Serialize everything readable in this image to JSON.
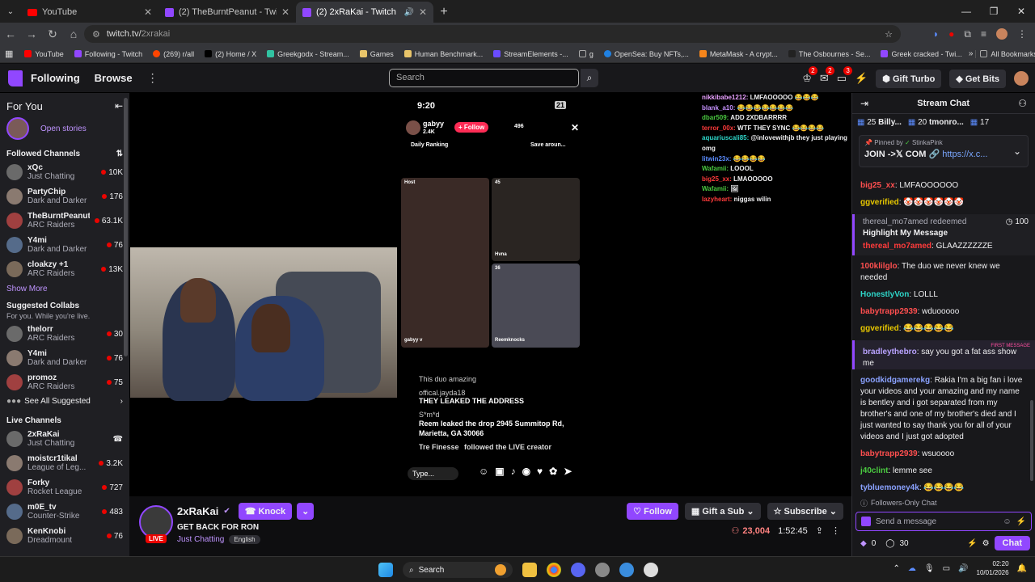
{
  "browser": {
    "tabs": [
      {
        "title": "YouTube",
        "favicon": "youtube-icon"
      },
      {
        "title": "(2) TheBurntPeanut - Twitch",
        "favicon": "twitch-icon"
      },
      {
        "title": "(2) 2xRaKai - Twitch",
        "favicon": "twitch-icon",
        "active": true
      }
    ],
    "url_host": "twitch.tv/",
    "url_path": "2xrakai",
    "bookmarks": [
      "YouTube",
      "Following - Twitch",
      "(269) r/all",
      "(2) Home / X",
      "Greekgodx - Stream...",
      "Games",
      "Human Benchmark...",
      "StreamElements -...",
      "g",
      "OpenSea: Buy NFTs,...",
      "MetaMask - A crypt...",
      "The Osbournes - Se...",
      "Greek cracked - Twi..."
    ],
    "all_bookmarks": "All Bookmarks"
  },
  "nav": {
    "following": "Following",
    "browse": "Browse",
    "search_placeholder": "Search",
    "notif_badges": [
      "2",
      "2",
      "3"
    ],
    "turbo": "Gift Turbo",
    "bits": "Get Bits"
  },
  "sidebar": {
    "for_you": "For You",
    "open_stories": "Open stories",
    "followed_title": "Followed Channels",
    "followed": [
      {
        "name": "xQc",
        "game": "Just Chatting",
        "viewers": "10K"
      },
      {
        "name": "PartyChip",
        "game": "Dark and Darker",
        "viewers": "176"
      },
      {
        "name": "TheBurntPeanut",
        "game": "ARC Raiders",
        "viewers": "63.1K"
      },
      {
        "name": "Y4mi",
        "game": "Dark and Darker",
        "viewers": "76"
      },
      {
        "name": "cloakzy +1",
        "game": "ARC Raiders",
        "viewers": "13K"
      }
    ],
    "show_more": "Show More",
    "suggested_title": "Suggested Collabs",
    "suggested_sub": "For you. While you're live.",
    "suggested": [
      {
        "name": "thelorr",
        "game": "ARC Raiders",
        "viewers": "30"
      },
      {
        "name": "Y4mi",
        "game": "Dark and Darker",
        "viewers": "76"
      },
      {
        "name": "promoz",
        "game": "ARC Raiders",
        "viewers": "75"
      }
    ],
    "see_all": "See All Suggested",
    "live_title": "Live Channels",
    "live": [
      {
        "name": "2xRaKai",
        "game": "Just Chatting",
        "viewers": ""
      },
      {
        "name": "moistcr1tikal",
        "game": "League of Leg...",
        "viewers": "3.2K"
      },
      {
        "name": "Forky",
        "game": "Rocket League",
        "viewers": "727"
      },
      {
        "name": "m0E_tv",
        "game": "Counter-Strike",
        "viewers": "483"
      },
      {
        "name": "KenKnobi",
        "game": "Dreadmount",
        "viewers": "76"
      }
    ]
  },
  "video": {
    "phone": {
      "time": "9:20",
      "battery": "21",
      "host": "gabyy",
      "host_likes": "2.4K",
      "follow": "+ Follow",
      "viewers": "496",
      "daily": "Daily Ranking",
      "save": "Save aroun...",
      "tiles": [
        "Host",
        "45",
        "Hvna",
        "36"
      ],
      "tile_names": [
        "gabyy v",
        "Reemknocks"
      ],
      "comments": [
        {
          "u": "",
          "t": "This duo amazing"
        },
        {
          "u": "offical.jayda18",
          "t": "THEY LEAKED THE ADDRESS"
        },
        {
          "u": "S*m*d",
          "t": "Reem leaked the drop  2945 Summitop Rd, Marietta, GA 30066"
        },
        {
          "u": "Tre Finesse",
          "t": "followed the LIVE creator"
        }
      ],
      "type_placeholder": "Type..."
    },
    "overlay_chat": [
      {
        "u": "nikkibabe1212:",
        "t": " LMFAOOOOO 😂😂😂",
        "c": "#e8a0ff"
      },
      {
        "u": "blank_a10:",
        "t": " 😂😂😂😂😂😂😂",
        "c": "#c792ff"
      },
      {
        "u": "dbar509:",
        "t": " ADD 2XDBARRRR",
        "c": "#4ac940"
      },
      {
        "u": "terror_00x:",
        "t": " WTF THEY SYNC 😂😂😂😂",
        "c": "#ff3b3b"
      },
      {
        "u": "aquariuscali85:",
        "t": " @inlovewithjb they just playing omg",
        "c": "#2ed6c9"
      },
      {
        "u": "litwin23x:",
        "t": " 😂😂😂😂",
        "c": "#5b8cff"
      },
      {
        "u": "Wafamii:",
        "t": " LOOOL",
        "c": "#4ac940"
      },
      {
        "u": "big25_xx:",
        "t": " LMAOOOOO",
        "c": "#ff3b3b"
      },
      {
        "u": "Wafamii:",
        "t": " 🖼",
        "c": "#4ac940"
      },
      {
        "u": "lazyheart:",
        "t": " niggas wilin",
        "c": "#ff3b3b"
      }
    ]
  },
  "stream": {
    "name": "2xRaKai",
    "title": "GET BACK FOR RON",
    "category": "Just Chatting",
    "tag": "English",
    "viewers": "23,004",
    "uptime": "1:52:45",
    "knock": "Knock",
    "follow": "Follow",
    "gift_sub": "Gift a Sub",
    "subscribe": "Subscribe",
    "live": "LIVE"
  },
  "chat": {
    "header": "Stream Chat",
    "leaderboard": [
      {
        "v": "25",
        "n": "Billy..."
      },
      {
        "v": "20",
        "n": "tmonro..."
      },
      {
        "v": "17",
        "n": ""
      }
    ],
    "pinned_by": "Pinned by",
    "pinned_user": "StinkaPink",
    "pinned_text": "JOIN ->𝕏 COM 🔗",
    "pinned_link": "https://x.c...",
    "messages": [
      {
        "u": "big25_xx",
        "t": ": LMFAOOOOOO",
        "c": "#ff4f4f"
      },
      {
        "u": "ggverified",
        "t": ": 🤡🤡🤡🤡🤡🤡",
        "c": "#e6c600"
      },
      {
        "u": "thereal_mo7amed",
        "t": ": GLAAZZZZZZE",
        "c": "#ff3b3b"
      },
      {
        "u": "100klilglo",
        "t": ": The duo we never knew we needed",
        "c": "#ff4f4f"
      },
      {
        "u": "HonestlyVon",
        "t": ": LOLLL",
        "c": "#2ed6c9"
      },
      {
        "u": "babytrapp2939",
        "t": ": wduooooo",
        "c": "#ff4f4f"
      },
      {
        "u": "ggverified",
        "t": ": 😂😂😂😂😂",
        "c": "#e6c600"
      },
      {
        "u": "bradleythebro",
        "t": ": say you got a fat ass show me",
        "c": "#b9a3ff"
      },
      {
        "u": "goodkidgamerekg",
        "t": ": Rakia I'm a big fan i love your videos and your amazing and my name is bentley and i got separated from my brother's and one of my brother's died and I just wanted to say thank you for all of your videos and I just got adopted",
        "c": "#8aa2ff"
      },
      {
        "u": "babytrapp2939",
        "t": ": wsuoooo",
        "c": "#ff4f4f"
      },
      {
        "u": "j40clint",
        "t": ": lemme see",
        "c": "#4ac940"
      },
      {
        "u": "tybluemoney4k",
        "t": ": 😂😂😂😂",
        "c": "#8aa2ff"
      }
    ],
    "redeem": {
      "user": "thereal_mo7amed",
      "action": "redeemed",
      "reward": "Highlight My Message",
      "cost": "100"
    },
    "first_message": "FIRST MESSAGE",
    "followers_only": "Followers-Only Chat",
    "send_placeholder": "Send a message",
    "bits": "0",
    "points": "30",
    "chat_btn": "Chat"
  },
  "taskbar": {
    "search": "Search",
    "time": "02:20",
    "date": "10/01/2026"
  }
}
